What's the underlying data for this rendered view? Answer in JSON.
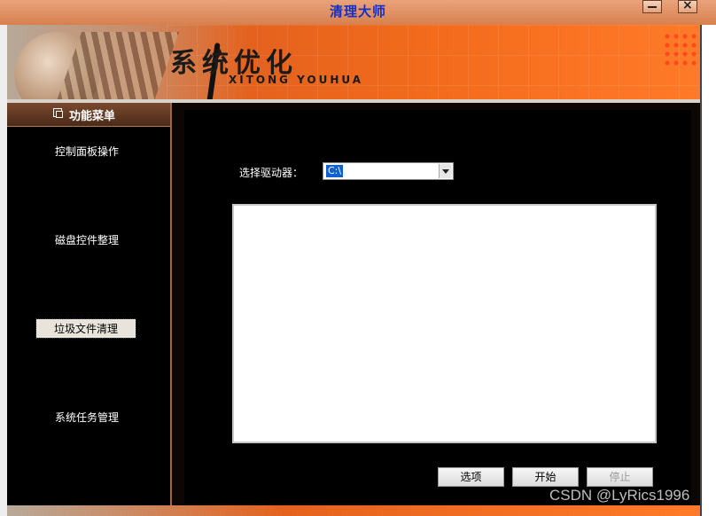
{
  "window": {
    "title": "清理大师"
  },
  "banner": {
    "title": "系统优化",
    "subtitle": "XITONG YOUHUA"
  },
  "menu": {
    "header": "功能菜单",
    "items": [
      {
        "label": "控制面板操作"
      },
      {
        "label": "磁盘控件整理"
      },
      {
        "label": "垃圾文件清理"
      },
      {
        "label": "系统任务管理"
      }
    ]
  },
  "main": {
    "drive_label": "选择驱动器：",
    "drive_value": "C:\\",
    "buttons": {
      "options": "选项",
      "start": "开始",
      "stop": "停止"
    }
  },
  "watermark": "CSDN @LyRics1996"
}
